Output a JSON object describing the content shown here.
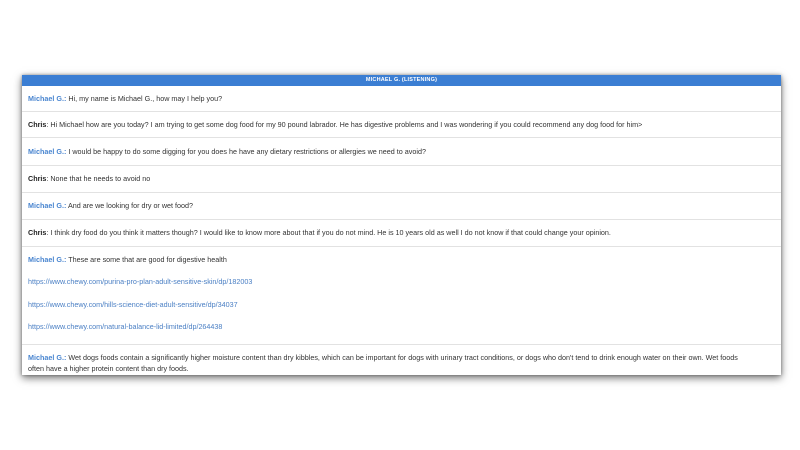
{
  "header": {
    "title": "MICHAEL G. (LISTENING)"
  },
  "messages": [
    {
      "sender": "Michael G.:",
      "text": " Hi, my name is Michael G., how may I help you?"
    },
    {
      "sender": "Chris",
      "text": ": Hi Michael how are you today? I am trying to get some dog food for my 90 pound labrador. He has digestive problems and I was wondering if you could recommend any dog food for him>"
    },
    {
      "sender": "Michael G.:",
      "text": " I would be happy to do some digging for you does he have any dietary restrictions or allergies we need to avoid?"
    },
    {
      "sender": "Chris",
      "text": ": None that he needs to avoid no"
    },
    {
      "sender": "Michael G.:",
      "text": " And are we looking for dry or wet food?"
    },
    {
      "sender": "Chris",
      "text": ": I think dry food do you think it matters though? I would like to know more about that if you do not mind. He is 10 years old as well I do not know if that could change your opinion."
    },
    {
      "sender": "Michael G.:",
      "text": " These are some that are good for digestive health",
      "links": [
        "https://www.chewy.com/purina-pro-plan-adult-sensitive-skin/dp/182003",
        "https://www.chewy.com/hills-science-diet-adult-sensitive/dp/34037",
        "https://www.chewy.com/natural-balance-lid-limited/dp/264438"
      ]
    },
    {
      "sender": "Michael G.:",
      "text_line1": " Wet dogs foods contain a significantly higher moisture content than dry kibbles, which can be important for dogs with urinary tract conditions, or dogs who don't tend to drink enough water on their own. Wet foods",
      "text_line2": "often have a higher protein content than dry foods."
    }
  ],
  "colors": {
    "header_bg": "#3b7ed3",
    "agent_name": "#4a86d0",
    "link": "#4a7fc4"
  }
}
